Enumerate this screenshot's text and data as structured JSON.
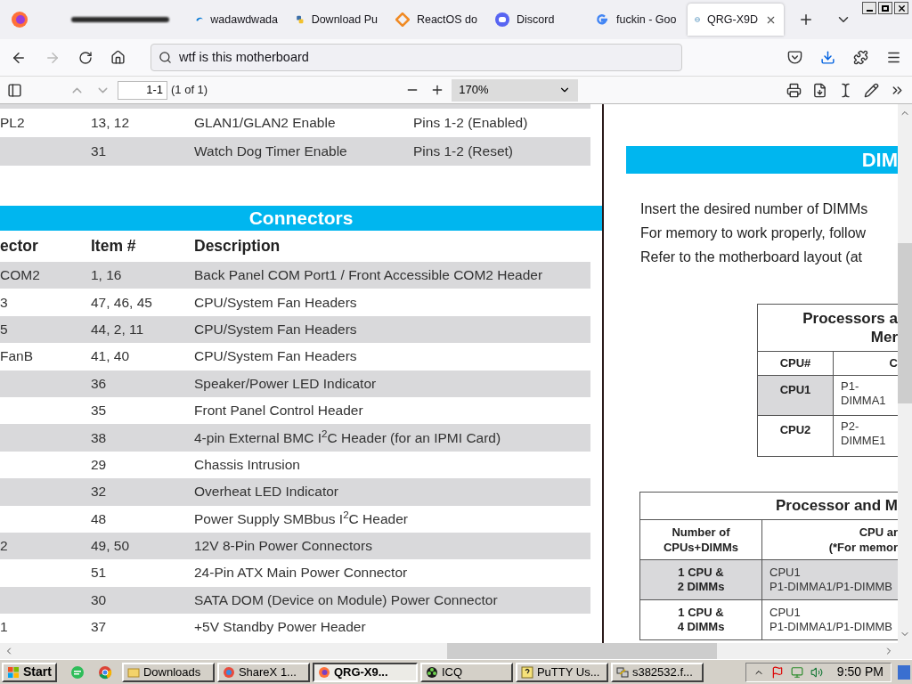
{
  "browser_tabs": [
    {
      "kind": "redacted",
      "selected": false
    },
    {
      "kind": "page",
      "title": "wadawdwada",
      "selected": false
    },
    {
      "kind": "page",
      "title": "Download Pu",
      "selected": false
    },
    {
      "kind": "page",
      "title": "ReactOS do",
      "selected": false
    },
    {
      "kind": "page",
      "title": "Discord",
      "selected": false
    },
    {
      "kind": "page",
      "title": "fuckin - Goo",
      "selected": false
    },
    {
      "kind": "page",
      "title": "QRG-X9D",
      "selected": true
    }
  ],
  "address_bar": {
    "value": "wtf is this motherboard"
  },
  "pdf_toolbar": {
    "page_value": "1-1",
    "page_count": "(1 of 1)",
    "zoom": "170%"
  },
  "left_page": {
    "jumper_rows": [
      {
        "cells": [
          "PL2",
          "13, 12",
          "GLAN1/GLAN2 Enable",
          "Pins 1-2 (Enabled)"
        ],
        "shaded": false
      },
      {
        "cells": [
          "",
          "31",
          "Watch Dog Timer Enable",
          "Pins 1-2 (Reset)"
        ],
        "shaded": true
      }
    ],
    "section_title": "Connectors",
    "columns": [
      "ector",
      "Item #",
      "Description"
    ],
    "rows": [
      {
        "cells": [
          "COM2",
          "1, 16",
          "Back Panel COM Port1 / Front Accessible COM2 Header"
        ],
        "shaded": true
      },
      {
        "cells": [
          "3",
          "47, 46, 45",
          "CPU/System Fan Headers"
        ],
        "shaded": false
      },
      {
        "cells": [
          "5",
          "44, 2, 11",
          "CPU/System Fan Headers"
        ],
        "shaded": true
      },
      {
        "cells": [
          "FanB",
          "41, 40",
          "CPU/System Fan Headers"
        ],
        "shaded": false
      },
      {
        "cells": [
          "",
          "36",
          "Speaker/Power LED Indicator"
        ],
        "shaded": true
      },
      {
        "cells": [
          "",
          "35",
          "Front Panel Control Header"
        ],
        "shaded": false
      },
      {
        "cells": [
          "",
          "38",
          "4-pin External BMC I$^{2}$C Header (for an IPMI Card)"
        ],
        "shaded": true
      },
      {
        "cells": [
          "",
          "29",
          "Chassis Intrusion"
        ],
        "shaded": false
      },
      {
        "cells": [
          "",
          "32",
          "Overheat LED Indicator"
        ],
        "shaded": true
      },
      {
        "cells": [
          "",
          "48",
          "Power Supply SMBbus I$^{2}$C Header"
        ],
        "shaded": false
      },
      {
        "cells": [
          "2",
          "49, 50",
          "12V 8-Pin Power Connectors"
        ],
        "shaded": true
      },
      {
        "cells": [
          "",
          "51",
          "24-Pin ATX Main Power Connector"
        ],
        "shaded": false
      },
      {
        "cells": [
          "",
          "30",
          "SATA DOM (Device on Module) Power Connector"
        ],
        "shaded": true
      },
      {
        "cells": [
          "1",
          "37",
          "+5V Standby Power Header"
        ],
        "shaded": false
      }
    ]
  },
  "right_page": {
    "section_title": "DIM",
    "paragraph_lines": [
      "Insert the desired number of DIMMs",
      "For memory to work properly, follow",
      "Refer to the motherboard layout (at"
    ],
    "table_1": {
      "title_lines": [
        "Processors a",
        "Mer"
      ],
      "columns": [
        "CPU#",
        "C"
      ],
      "rows": [
        {
          "cells": [
            "CPU1",
            "P1-DIMMA1"
          ],
          "shaded": true
        },
        {
          "cells": [
            "CPU2",
            "P2-DIMME1"
          ],
          "shaded": false
        }
      ]
    },
    "table_2": {
      "title": "Processor and M",
      "columns": [
        "Number of\nCPUs+DIMMs",
        "CPU ar\n(*For memor"
      ],
      "rows": [
        {
          "cells": [
            "1 CPU &\n2 DIMMs",
            "CPU1\nP1-DIMMA1/P1-DIMMB"
          ],
          "shaded": true
        },
        {
          "cells": [
            "1 CPU &\n4 DIMMs",
            "CPU1\nP1-DIMMA1/P1-DIMMB"
          ],
          "shaded": false
        }
      ]
    }
  },
  "taskbar": {
    "start": "Start",
    "tasks": [
      {
        "label": "Downloads",
        "selected": false
      },
      {
        "label": "ShareX 1...",
        "selected": false
      },
      {
        "label": "QRG-X9...",
        "selected": true
      },
      {
        "label": "ICQ",
        "selected": false
      },
      {
        "label": "PuTTY Us...",
        "selected": false
      },
      {
        "label": "s382532.f...",
        "selected": false
      }
    ],
    "clock": "9:50 PM"
  }
}
